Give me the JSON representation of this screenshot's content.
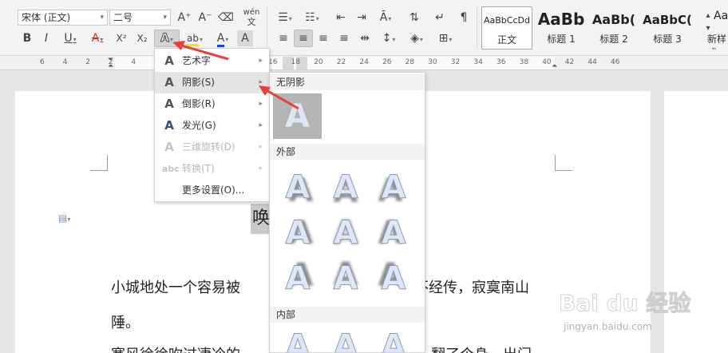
{
  "toolbar": {
    "font_name": "宋体 (正文)",
    "font_size": "二号",
    "grow_font_label": "A⁺",
    "shrink_font_label": "A⁻",
    "phonetic_label": "wén",
    "bold_label": "B",
    "italic_label": "I",
    "underline_label": "U",
    "strike_label": "A",
    "superscript_label": "X²",
    "subscript_label": "X₂",
    "text_effect_label": "A",
    "highlight_label": "ab",
    "font_color_label": "A",
    "char_shading_label": "A"
  },
  "styles": [
    {
      "preview": "AaBbCcDd",
      "label": "正文"
    },
    {
      "preview": "AaBb",
      "label": "标题 1"
    },
    {
      "preview": "AaBb(",
      "label": "标题 2"
    },
    {
      "preview": "AaBbC(",
      "label": "标题 3"
    },
    {
      "preview": "Aa",
      "label": "新样式"
    }
  ],
  "ruler": {
    "numbers": [
      "6",
      "4",
      "2",
      "2",
      "4",
      "6",
      "8",
      "10",
      "12",
      "14",
      "16",
      "18",
      "20",
      "22",
      "24",
      "26",
      "28",
      "30",
      "32",
      "34",
      "36",
      "38",
      "40",
      "42",
      "44",
      "46"
    ]
  },
  "text_effects_menu": {
    "items": [
      {
        "label": "艺术字",
        "icon": "A",
        "state": "normal"
      },
      {
        "label": "阴影(S)",
        "icon": "A",
        "state": "hover"
      },
      {
        "label": "倒影(R)",
        "icon": "A",
        "state": "normal"
      },
      {
        "label": "发光(G)",
        "icon": "A",
        "state": "normal"
      },
      {
        "label": "三维旋转(D)",
        "icon": "A",
        "state": "disabled"
      },
      {
        "label": "转换(T)",
        "icon": "abc",
        "state": "disabled"
      },
      {
        "label": "更多设置(O)...",
        "icon": "",
        "state": "normal"
      }
    ]
  },
  "shadow_submenu": {
    "no_shadow_header": "无阴影",
    "no_shadow_glyph": "A",
    "outer_header": "外部",
    "inner_header": "内部",
    "tile_glyph": "A"
  },
  "document": {
    "title_fragment": "唤",
    "line1_part1": "小城地处一个容易被",
    "line1_part2": "不经传，寂寞南山",
    "line2": "陲。",
    "line3_part1": "寒风徐徐吹过凄冷的",
    "line3_part2": "翻了个身，出门"
  },
  "watermark": {
    "brand": "Bai du 经验",
    "url": "jingyan.baidu.com"
  },
  "colors": {
    "toolbar_bg": "#f3f3f3",
    "menu_hover": "#e4e4e4",
    "annotation_arrow": "#e8413b",
    "selection_gray": "#c9c9c9"
  }
}
